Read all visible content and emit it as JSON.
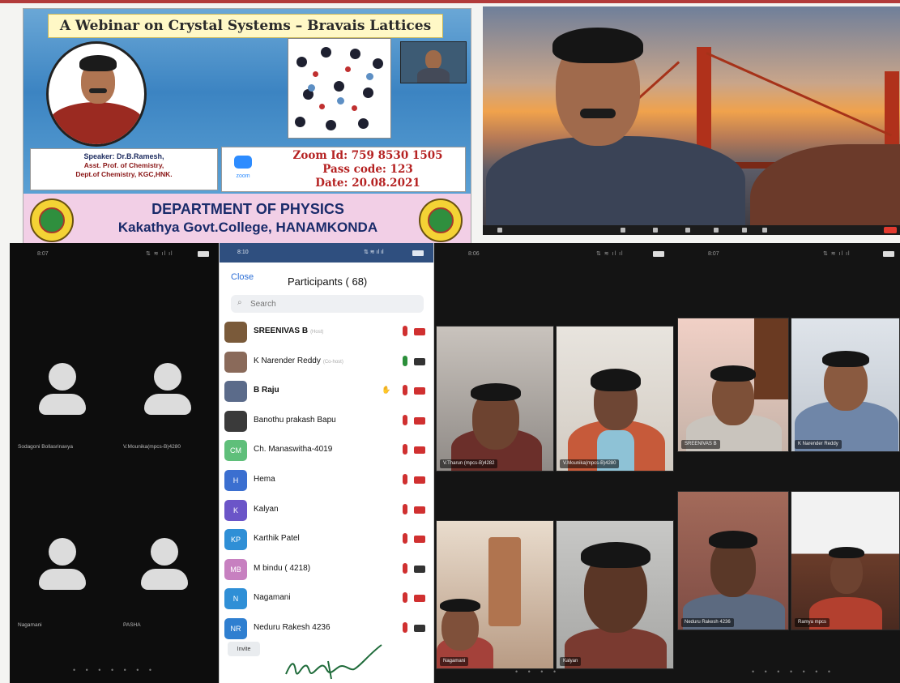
{
  "poster": {
    "title": "A Webinar on Crystal Systems – Bravais Lattices",
    "speaker_lines": [
      "Speaker: Dr.B.Ramesh,",
      "Asst. Prof. of Chemistry,",
      "Dept.of Chemistry, KGC,HNK."
    ],
    "zoom_logo_text": "zoom",
    "zoom_id": "Zoom Id: 759 8530 1505",
    "pass_code": "Pass code: 123",
    "date": "Date: 20.08.2021",
    "department": "DEPARTMENT OF PHYSICS",
    "college": "Kakathya Govt.College, HANAMKONDA"
  },
  "phone_left": {
    "time": "8:07",
    "tiles": [
      {
        "name": "Sodagoni Bollasrinavya"
      },
      {
        "name": "V.Mounika(mpcs-B)4280"
      },
      {
        "name": "Nagamani"
      },
      {
        "name": "PASHA"
      }
    ]
  },
  "participants": {
    "time": "8:10",
    "close_label": "Close",
    "title": "Participants ( 68)",
    "search_placeholder": "Search",
    "invite_label": "Invite",
    "rows": [
      {
        "name": "SREENIVAS B",
        "tag": "(Host)",
        "initials": "",
        "color": "#7a5a3a",
        "bold": true
      },
      {
        "name": "K Narender Reddy",
        "tag": "(Co-host)",
        "initials": "",
        "color": "#8a6a5a",
        "bold": false
      },
      {
        "name": "B Raju",
        "tag": "",
        "initials": "",
        "color": "#5b6b8a",
        "bold": true
      },
      {
        "name": "Banothu prakash Bapu",
        "tag": "",
        "initials": "",
        "color": "#3a3a3a",
        "bold": false
      },
      {
        "name": "Ch. Manaswitha-4019",
        "tag": "",
        "initials": "CM",
        "color": "#5fbf7a",
        "bold": false
      },
      {
        "name": "Hema",
        "tag": "",
        "initials": "H",
        "color": "#3b6fd0",
        "bold": false
      },
      {
        "name": "Kalyan",
        "tag": "",
        "initials": "K",
        "color": "#6b55c8",
        "bold": false
      },
      {
        "name": "Karthik Patel",
        "tag": "",
        "initials": "KP",
        "color": "#2f8fd6",
        "bold": false
      },
      {
        "name": "M bindu ( 4218)",
        "tag": "",
        "initials": "MB",
        "color": "#c780c0",
        "bold": false
      },
      {
        "name": "Nagamani",
        "tag": "",
        "initials": "N",
        "color": "#2f8fd6",
        "bold": false
      },
      {
        "name": "Neduru Rakesh 4236",
        "tag": "",
        "initials": "NR",
        "color": "#2f7fd0",
        "bold": false
      }
    ]
  },
  "phone_grid1": {
    "time": "8:06",
    "tiles": [
      {
        "name": "V.Tharun (mpcs-B)4282"
      },
      {
        "name": "V.Mounika(mpcs-B)4280"
      },
      {
        "name": "Nagamani"
      },
      {
        "name": "Kalyan"
      }
    ]
  },
  "phone_grid2": {
    "time": "8:07",
    "tiles": [
      {
        "name": "SREENIVAS B"
      },
      {
        "name": "K Narender Reddy"
      },
      {
        "name": "Neduru Rakesh 4236"
      },
      {
        "name": "Ramya mpcs"
      }
    ]
  },
  "colors": {
    "zoom_blue": "#2d8cff",
    "mic_muted": "#d03030",
    "mic_active": "#2b8f3a"
  }
}
